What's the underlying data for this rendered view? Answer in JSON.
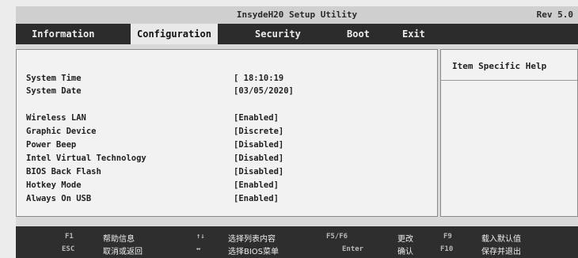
{
  "header": {
    "title": "InsydeH20 Setup Utility",
    "rev": "Rev 5.0"
  },
  "tabs": [
    "Information",
    "Configuration",
    "Security",
    "Boot",
    "Exit"
  ],
  "active_tab": "Configuration",
  "settings": [
    {
      "label": "System Time",
      "value": "[ 18:10:19"
    },
    {
      "label": "System Date",
      "value": "[03/05/2020]"
    },
    {
      "label": "Wireless LAN",
      "value": "[Enabled]"
    },
    {
      "label": "Graphic Device",
      "value": "[Discrete]"
    },
    {
      "label": "Power Beep",
      "value": "[Disabled]"
    },
    {
      "label": "Intel Virtual Technology",
      "value": "[Disabled]"
    },
    {
      "label": "BIOS Back Flash",
      "value": "[Disabled]"
    },
    {
      "label": "Hotkey Mode",
      "value": "[Enabled]"
    },
    {
      "label": "Always On USB",
      "value": "[Enabled]"
    }
  ],
  "help": {
    "title": "Item Specific Help"
  },
  "footer": {
    "keys": [
      {
        "key": "F1",
        "desc": "帮助信息"
      },
      {
        "key": "F5/F6",
        "desc": "更改"
      },
      {
        "key": "F9",
        "desc": "载入默认值"
      },
      {
        "key": "ESC",
        "desc": "取消或返回"
      },
      {
        "key": "Enter",
        "desc": "确认"
      },
      {
        "key": "F10",
        "desc": "保存并退出"
      }
    ],
    "arrows": [
      {
        "key": "↑↓",
        "desc": "选择列表内容"
      },
      {
        "key": "↔",
        "desc": "选择BIOS菜单"
      }
    ]
  }
}
